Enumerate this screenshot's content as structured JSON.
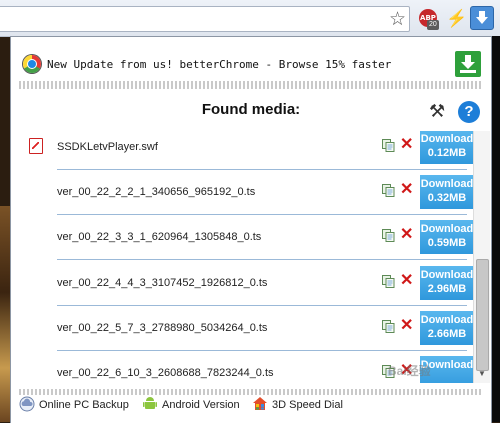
{
  "toolbar": {
    "extension_badge": "ABP",
    "extension_count": "20"
  },
  "banner": {
    "text": "New Update from us! betterChrome - Browse 15% faster"
  },
  "title": "Found media:",
  "help": "?",
  "media": [
    {
      "name": "SSDKLetvPlayer.swf",
      "button": "Download",
      "size": "0.12MB",
      "has_icon": true
    },
    {
      "name": "ver_00_22_2_2_1_340656_965192_0.ts",
      "button": "Download",
      "size": "0.32MB"
    },
    {
      "name": "ver_00_22_3_3_1_620964_1305848_0.ts",
      "button": "Download",
      "size": "0.59MB"
    },
    {
      "name": "ver_00_22_4_4_3_3107452_1926812_0.ts",
      "button": "Download",
      "size": "2.96MB"
    },
    {
      "name": "ver_00_22_5_7_3_2788980_5034264_0.ts",
      "button": "Download",
      "size": "2.66MB"
    },
    {
      "name": "ver_00_22_6_10_3_2608688_7823244_0.ts",
      "button": "Download",
      "size": ""
    }
  ],
  "footer": {
    "backup": "Online PC Backup",
    "android": "Android Version",
    "speed_dial": "3D Speed Dial"
  },
  "colors": {
    "download_button": "#3aa3e3",
    "delete_icon": "#d01818",
    "download_icon": "#2ea03b"
  }
}
